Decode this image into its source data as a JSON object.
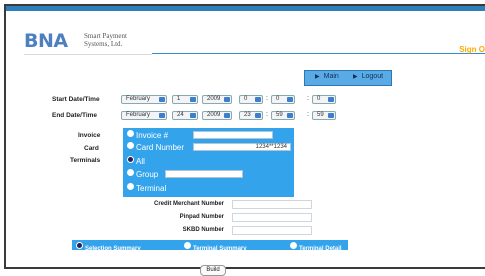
{
  "header": {
    "logo_text": "BNA",
    "company_line1": "Smart Payment",
    "company_line2": "Systems, Ltd.",
    "sign_out": "Sign O"
  },
  "nav": {
    "main_label": "Main",
    "logout_label": "Logout"
  },
  "date_range": {
    "start_label": "Start Date/Time",
    "end_label": "End Date/Time",
    "start": {
      "month": "February",
      "day": "1",
      "year": "2009",
      "hour": "0",
      "minute": "0",
      "second": "0"
    },
    "end": {
      "month": "February",
      "day": "24",
      "year": "2009",
      "hour": "23",
      "minute": "59",
      "second": "59"
    }
  },
  "filters": {
    "invoice_label": "Invoice",
    "card_label": "Card",
    "terminals_label": "Terminals",
    "invoice_option": "Invoice #",
    "card_option": "Card Number",
    "card_value": "1234**1234",
    "all_option": "All",
    "group_option": "Group",
    "terminal_option": "Terminal"
  },
  "merchant": {
    "credit_label": "Credit Merchant Number",
    "pinpad_label": "Pinpad Number",
    "skbd_label": "SKBD Number"
  },
  "summary": {
    "selection": "Selection Summary",
    "terminal_summary": "Terminal Summary",
    "terminal_detail": "Terminal Detail"
  },
  "build_label": "Build"
}
